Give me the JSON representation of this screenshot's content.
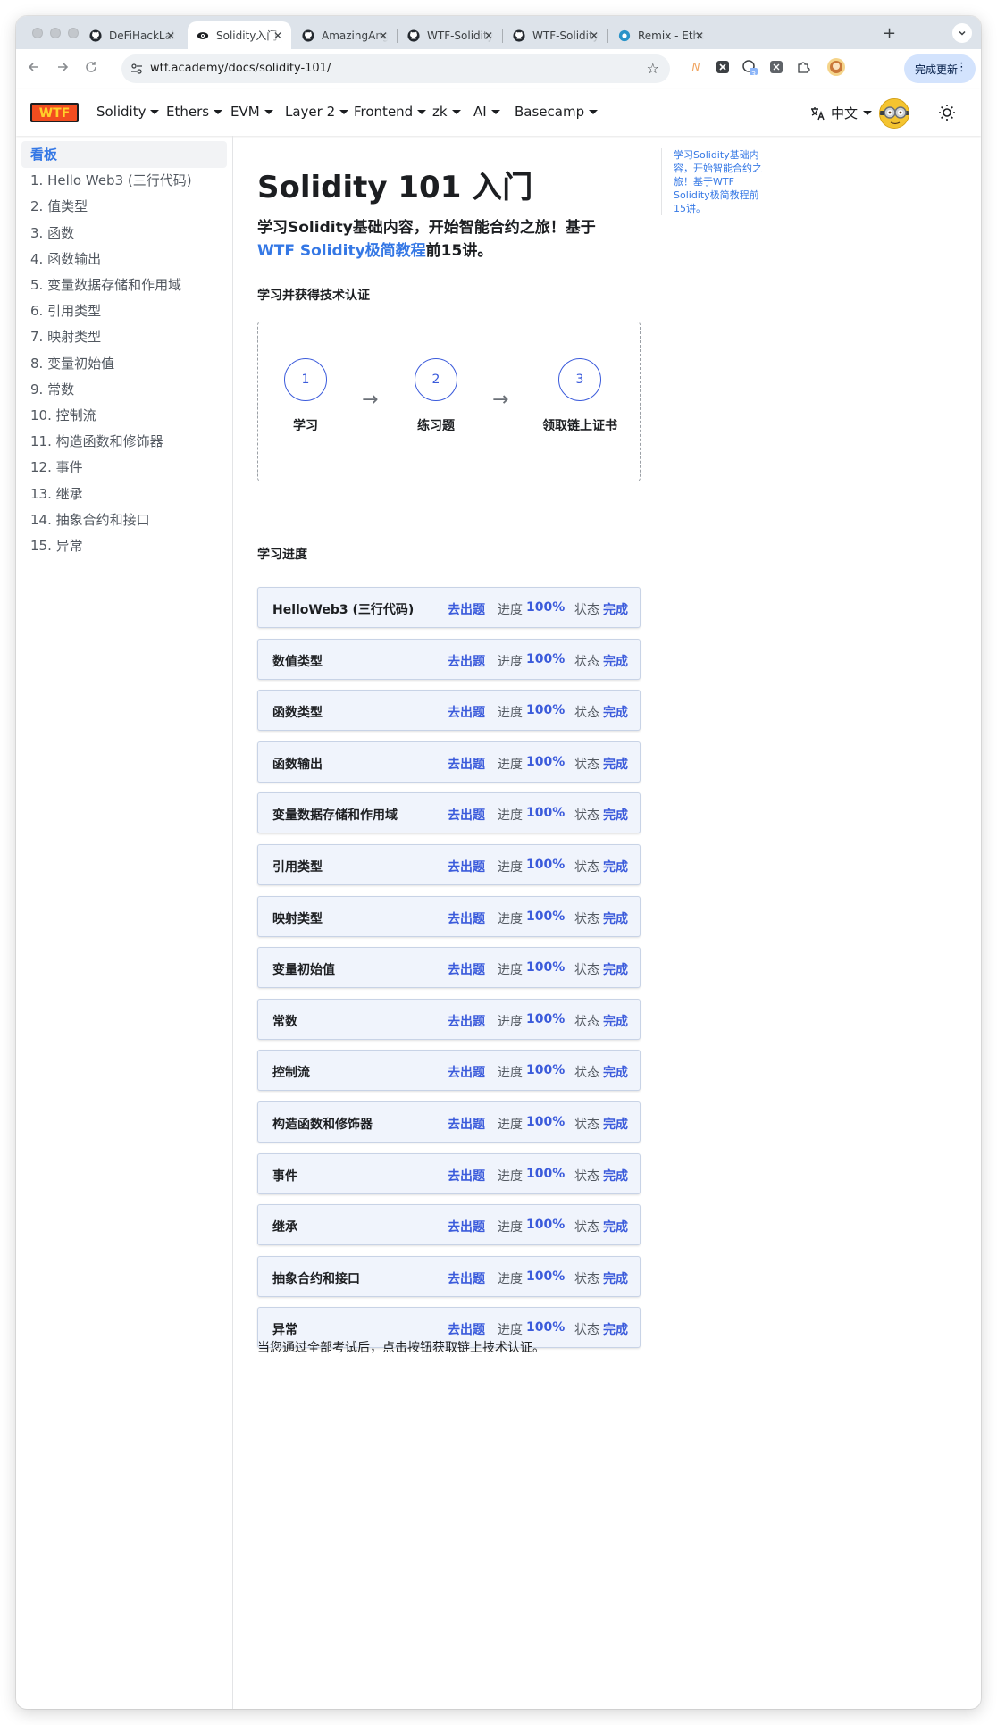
{
  "browser": {
    "tabs": [
      {
        "title": "DeFiHackLabs",
        "icon": "github-icon",
        "active": false
      },
      {
        "title": "Solidity入门 |",
        "icon": "wtf-eye-icon",
        "active": true
      },
      {
        "title": "AmazingAng",
        "icon": "github-icon",
        "active": false
      },
      {
        "title": "WTF-Solidity",
        "icon": "github-icon",
        "active": false
      },
      {
        "title": "WTF-Solidity",
        "icon": "github-icon",
        "active": false
      },
      {
        "title": "Remix - Ethe",
        "icon": "remix-icon",
        "active": false
      }
    ],
    "new_tab_glyph": "+",
    "url": "wtf.academy/docs/solidity-101/",
    "extension_badge": "3",
    "update_button_label": "完成更新"
  },
  "site": {
    "logo_text": "WTF",
    "nav": [
      "Solidity",
      "Ethers",
      "EVM",
      "Layer 2",
      "Frontend",
      "zk",
      "AI",
      "Basecamp"
    ],
    "language_label": "中文"
  },
  "sidebar": {
    "items": [
      "看板",
      "1. Hello Web3 (三行代码)",
      "2. 值类型",
      "3. 函数",
      "4. 函数输出",
      "5. 变量数据存储和作用域",
      "6. 引用类型",
      "7. 映射类型",
      "8. 变量初始值",
      "9. 常数",
      "10. 控制流",
      "11. 构造函数和修饰器",
      "12. 事件",
      "13. 继承",
      "14. 抽象合约和接口",
      "15. 异常"
    ],
    "active_index": 0
  },
  "main": {
    "title": "Solidity 101 入门",
    "intro_text": "学习Solidity基础内容，开始智能合约之旅！基于",
    "intro_link": "WTF Solidity极简教程",
    "intro_suffix": "前15讲。",
    "cert_heading": "学习并获得技术认证",
    "steps": [
      {
        "number": "1",
        "label": "学习"
      },
      {
        "number": "2",
        "label": "练习题"
      },
      {
        "number": "3",
        "label": "领取链上证书"
      }
    ],
    "arrow_glyph": "→",
    "progress_heading": "学习进度",
    "progress_rows": [
      {
        "lesson": "HelloWeb3 (三行代码)",
        "quiz": "去出题",
        "progress_label": "进度",
        "progress": "100%",
        "status_label": "状态",
        "status": "完成"
      },
      {
        "lesson": "数值类型",
        "quiz": "去出题",
        "progress_label": "进度",
        "progress": "100%",
        "status_label": "状态",
        "status": "完成"
      },
      {
        "lesson": "函数类型",
        "quiz": "去出题",
        "progress_label": "进度",
        "progress": "100%",
        "status_label": "状态",
        "status": "完成"
      },
      {
        "lesson": "函数输出",
        "quiz": "去出题",
        "progress_label": "进度",
        "progress": "100%",
        "status_label": "状态",
        "status": "完成"
      },
      {
        "lesson": "变量数据存储和作用域",
        "quiz": "去出题",
        "progress_label": "进度",
        "progress": "100%",
        "status_label": "状态",
        "status": "完成"
      },
      {
        "lesson": "引用类型",
        "quiz": "去出题",
        "progress_label": "进度",
        "progress": "100%",
        "status_label": "状态",
        "status": "完成"
      },
      {
        "lesson": "映射类型",
        "quiz": "去出题",
        "progress_label": "进度",
        "progress": "100%",
        "status_label": "状态",
        "status": "完成"
      },
      {
        "lesson": "变量初始值",
        "quiz": "去出题",
        "progress_label": "进度",
        "progress": "100%",
        "status_label": "状态",
        "status": "完成"
      },
      {
        "lesson": "常数",
        "quiz": "去出题",
        "progress_label": "进度",
        "progress": "100%",
        "status_label": "状态",
        "status": "完成"
      },
      {
        "lesson": "控制流",
        "quiz": "去出题",
        "progress_label": "进度",
        "progress": "100%",
        "status_label": "状态",
        "status": "完成"
      },
      {
        "lesson": "构造函数和修饰器",
        "quiz": "去出题",
        "progress_label": "进度",
        "progress": "100%",
        "status_label": "状态",
        "status": "完成"
      },
      {
        "lesson": "事件",
        "quiz": "去出题",
        "progress_label": "进度",
        "progress": "100%",
        "status_label": "状态",
        "status": "完成"
      },
      {
        "lesson": "继承",
        "quiz": "去出题",
        "progress_label": "进度",
        "progress": "100%",
        "status_label": "状态",
        "status": "完成"
      },
      {
        "lesson": "抽象合约和接口",
        "quiz": "去出题",
        "progress_label": "进度",
        "progress": "100%",
        "status_label": "状态",
        "status": "完成"
      },
      {
        "lesson": "异常",
        "quiz": "去出题",
        "progress_label": "进度",
        "progress": "100%",
        "status_label": "状态",
        "status": "完成"
      }
    ],
    "footer_note": "当您通过全部考试后，点击按钮获取链上技术认证。"
  },
  "toc": {
    "text": "学习Solidity基础内容，开始智能合约之旅！基于WTF Solidity极简教程前15讲。"
  },
  "colors": {
    "accent": "#3b5bdb",
    "link": "#3578e5",
    "row_bg": "#f0f4fc"
  }
}
